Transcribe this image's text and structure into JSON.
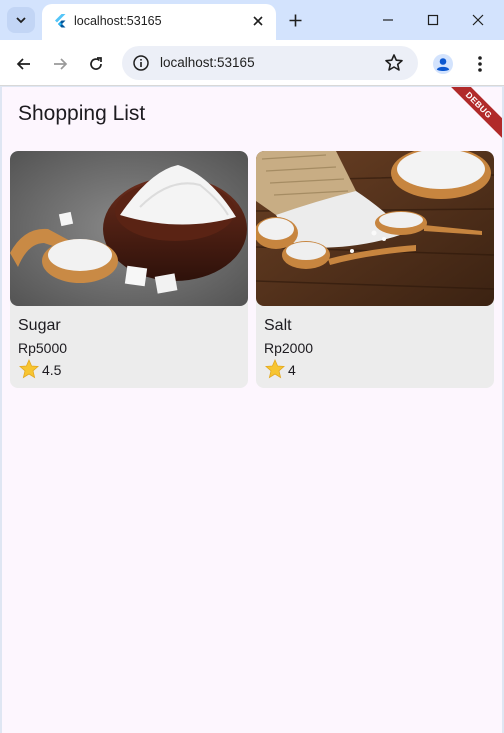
{
  "browser": {
    "tab_title": "localhost:53165",
    "url": "localhost:53165"
  },
  "icons": {
    "tab_search": "chevron-down-icon",
    "favicon": "flutter-icon",
    "tab_close": "close-icon",
    "new_tab": "plus-icon",
    "minimize": "minimize-icon",
    "maximize": "maximize-icon",
    "close_window": "close-icon",
    "back": "arrow-left-icon",
    "forward": "arrow-right-icon",
    "reload": "reload-icon",
    "site_info": "info-icon",
    "bookmark": "star-outline-icon",
    "profile": "person-icon",
    "menu": "kebab-menu-icon",
    "rating_star": "star-icon"
  },
  "app": {
    "title": "Shopping List",
    "debug_banner": "DEBUG"
  },
  "products": [
    {
      "name": "Sugar",
      "price": "Rp5000",
      "rating": "4.5",
      "image": "sugar-photo"
    },
    {
      "name": "Salt",
      "price": "Rp2000",
      "rating": "4",
      "image": "salt-photo"
    }
  ],
  "colors": {
    "tabstrip": "#d3e3fd",
    "app_background": "#fdf6fe",
    "card_background": "#ececec",
    "debug_banner": "#b12a2a",
    "star": "#f7c531"
  }
}
